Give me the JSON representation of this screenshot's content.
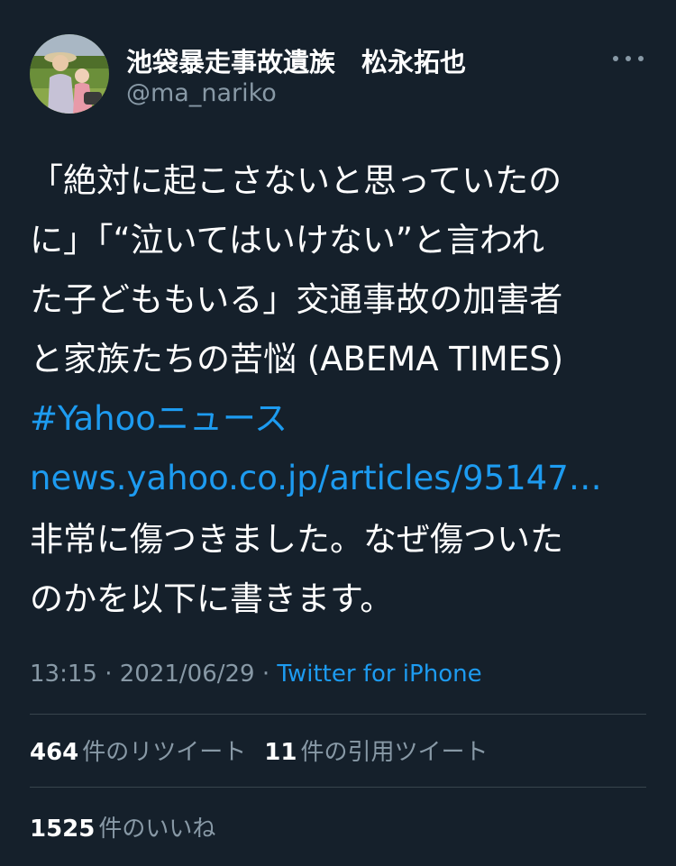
{
  "tweet": {
    "author": {
      "display_name": "池袋暴走事故遺族　松永拓也",
      "handle": "@ma_nariko"
    },
    "text_lines": [
      "「絶対に起こさないと思っていたの",
      "に」「“泣いてはいけない”と言われ",
      "た子どももいる」交通事故の加害者",
      "と家族たちの苦悩 (ABEMA TIMES)"
    ],
    "hashtag": "#Yahooニュース",
    "link": "news.yahoo.co.jp/articles/95147…",
    "comment_lines": [
      "非常に傷つきました。なぜ傷ついた",
      "のかを以下に書きます。"
    ],
    "time": "13:15",
    "date": "2021/06/29",
    "source": "Twitter for iPhone",
    "separator": " · "
  },
  "stats": {
    "retweets_count": "464",
    "retweets_label": "件のリツイート",
    "quotes_count": "11",
    "quotes_label": "件の引用ツイート",
    "likes_count": "1525",
    "likes_label": "件のいいね"
  },
  "icons": {
    "more": "more-dots-icon"
  },
  "colors": {
    "background": "#15202b",
    "text": "#ffffff",
    "secondary": "#8899a6",
    "link": "#1d9bf0",
    "divider": "#38444d"
  }
}
